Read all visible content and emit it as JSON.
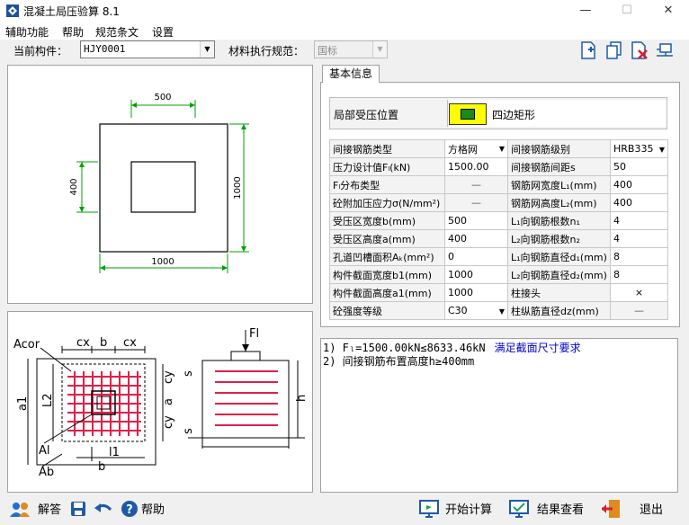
{
  "window": {
    "title": "混凝土局压验算 8.1"
  },
  "menu": [
    "辅助功能",
    "帮助",
    "规范条文",
    "设置"
  ],
  "toolbar": {
    "component_label": "当前构件：",
    "component_value": "HJY0001",
    "code_label": "材料执行规范：",
    "code_value": "国标"
  },
  "tab": {
    "label": "基本信息"
  },
  "position": {
    "label": "局部受压位置",
    "value": "四边矩形",
    "swatch_color": "#1a8a1a",
    "frame_color": "#ffff00"
  },
  "params": [
    {
      "l1": "间接钢筋类型",
      "v1": "方格网",
      "t1": "combo",
      "l2": "间接钢筋级别",
      "v2": "HRB335",
      "t2": "combo"
    },
    {
      "l1": "压力设计值Fₗ(kN)",
      "v1": "1500.00",
      "t1": "val",
      "l2": "间接钢筋间距s",
      "v2": "50",
      "t2": "val"
    },
    {
      "l1": "Fₗ分布类型",
      "v1": "—",
      "t1": "dis",
      "l2": "钢筋网宽度L₁(mm)",
      "v2": "400",
      "t2": "val"
    },
    {
      "l1": "砼附加压应力σ(N/mm²)",
      "v1": "—",
      "t1": "dis",
      "l2": "钢筋网高度L₂(mm)",
      "v2": "400",
      "t2": "val"
    },
    {
      "l1": "受压区宽度b(mm)",
      "v1": "500",
      "t1": "val",
      "l2": "L₁向钢筋根数n₁",
      "v2": "4",
      "t2": "val"
    },
    {
      "l1": "受压区高度a(mm)",
      "v1": "400",
      "t1": "val",
      "l2": "L₂向钢筋根数n₂",
      "v2": "4",
      "t2": "val"
    },
    {
      "l1": "孔道凹槽面积Aₖ(mm²)",
      "v1": "0",
      "t1": "val",
      "l2": "L₁向钢筋直径d₁(mm)",
      "v2": "8",
      "t2": "val"
    },
    {
      "l1": "构件截面宽度b1(mm)",
      "v1": "1000",
      "t1": "val",
      "l2": "L₂向钢筋直径d₂(mm)",
      "v2": "8",
      "t2": "val"
    },
    {
      "l1": "构件截面高度a1(mm)",
      "v1": "1000",
      "t1": "val",
      "l2": "柱接头",
      "v2": "×",
      "t2": "ctr"
    },
    {
      "l1": "砼强度等级",
      "v1": "C30",
      "t1": "combo",
      "l2": "柱纵筋直径dz(mm)",
      "v2": "—",
      "t2": "dis"
    }
  ],
  "results": [
    {
      "text": "1) Fₗ=1500.00kN≤8633.46kN",
      "note": "满足截面尺寸要求",
      "note_color": "#0000cc"
    },
    {
      "text": "2) 间接钢筋布置高度h≥400mm",
      "note": ""
    }
  ],
  "plan_drawing": {
    "dim_top": "500",
    "dim_left": "400",
    "dim_right": "1000",
    "dim_bottom": "1000"
  },
  "schematic": {
    "acor": "Acor",
    "cx1": "cx",
    "b": "b",
    "cx2": "cx",
    "l1": "l1",
    "l2": "L2",
    "cy1": "cy",
    "a": "a",
    "cy2": "cy",
    "al": "Al",
    "ab": "Ab",
    "b_bottom": "b",
    "fl": "Fl",
    "s1": "s",
    "s2": "s",
    "h": "h"
  },
  "bottom": {
    "answer": "解答",
    "help": "帮助",
    "calc": "开始计算",
    "view": "结果查看",
    "exit": "退出"
  }
}
